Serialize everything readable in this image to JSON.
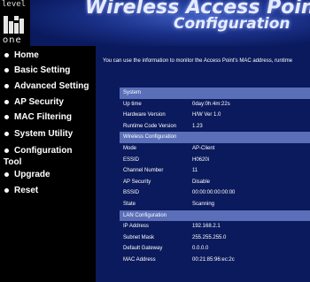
{
  "header": {
    "logo_top": "level",
    "logo_bottom": "one",
    "title_line1": "Wireless Access Point",
    "title_line2": "Configuration"
  },
  "sidebar": {
    "items": [
      {
        "label": "Home"
      },
      {
        "label": "Basic Setting"
      },
      {
        "label": "Advanced Setting"
      },
      {
        "label": "AP Security"
      },
      {
        "label": "MAC Filtering"
      },
      {
        "label": "System Utility"
      },
      {
        "label": "Configuration",
        "label2": "Tool"
      },
      {
        "label": "Upgrade"
      },
      {
        "label": "Reset"
      }
    ]
  },
  "main": {
    "intro": "You can use the information to monitor the Access Point's MAC address, runtime"
  },
  "status": {
    "system": {
      "title": "System",
      "rows": [
        {
          "k": "Up time",
          "v": "0day:0h:4m:22s"
        },
        {
          "k": "Hardware Version",
          "v": "H/W Ver 1.0"
        },
        {
          "k": "Runtime Code Version",
          "v": "1.23"
        }
      ]
    },
    "wireless": {
      "title": "Wireless Configuration",
      "rows": [
        {
          "k": "Mode",
          "v": "AP-Client"
        },
        {
          "k": "ESSID",
          "v": "H0620i"
        },
        {
          "k": "Channel Number",
          "v": "11"
        },
        {
          "k": "AP Security",
          "v": "Disable"
        },
        {
          "k": "BSSID",
          "v": "00:00:00:00:00:00"
        },
        {
          "k": "State",
          "v": "Scanning"
        }
      ]
    },
    "lan": {
      "title": "LAN Configuration",
      "rows": [
        {
          "k": "IP Address",
          "v": "192.168.2.1"
        },
        {
          "k": "Subnet Mask",
          "v": "255.255.255.0"
        },
        {
          "k": "Default Gateway",
          "v": "0.0.0.0"
        },
        {
          "k": "MAC Address",
          "v": "00:21:85:96:ec:2c"
        }
      ]
    }
  }
}
